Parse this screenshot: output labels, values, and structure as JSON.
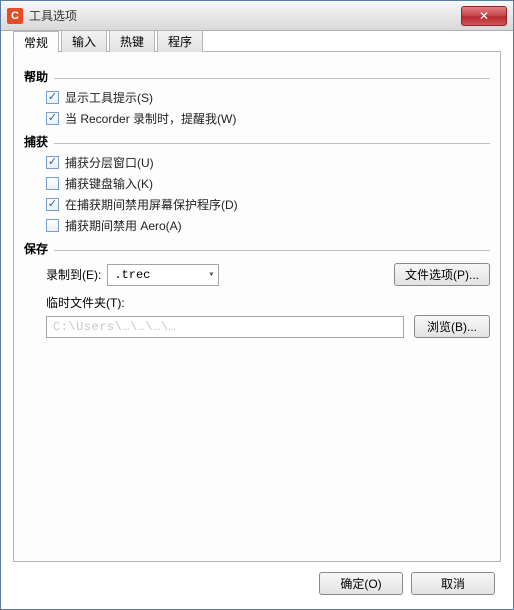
{
  "window": {
    "title": "工具选项",
    "app_icon_letter": "C"
  },
  "tabs": [
    {
      "label": "常规",
      "active": true
    },
    {
      "label": "输入",
      "active": false
    },
    {
      "label": "热键",
      "active": false
    },
    {
      "label": "程序",
      "active": false
    }
  ],
  "sections": {
    "help": {
      "title": "帮助"
    },
    "capture": {
      "title": "捕获"
    },
    "save": {
      "title": "保存"
    }
  },
  "help_options": [
    {
      "label": "显示工具提示(S)",
      "checked": true
    },
    {
      "label": "当 Recorder 录制时，提醒我(W)",
      "checked": true
    }
  ],
  "capture_options": [
    {
      "label": "捕获分层窗口(U)",
      "checked": true
    },
    {
      "label": "捕获键盘输入(K)",
      "checked": false
    },
    {
      "label": "在捕获期间禁用屏幕保护程序(D)",
      "checked": true
    },
    {
      "label": "捕获期间禁用 Aero(A)",
      "checked": false
    }
  ],
  "save_row": {
    "record_to_label": "录制到(E):",
    "format_value": ".trec",
    "file_options_btn": "文件选项(P)..."
  },
  "temp_folder": {
    "label": "临时文件夹(T):",
    "value": "C:\\Users\\…\\…\\…\\…",
    "browse_btn": "浏览(B)..."
  },
  "footer": {
    "ok": "确定(O)",
    "cancel": "取消"
  }
}
